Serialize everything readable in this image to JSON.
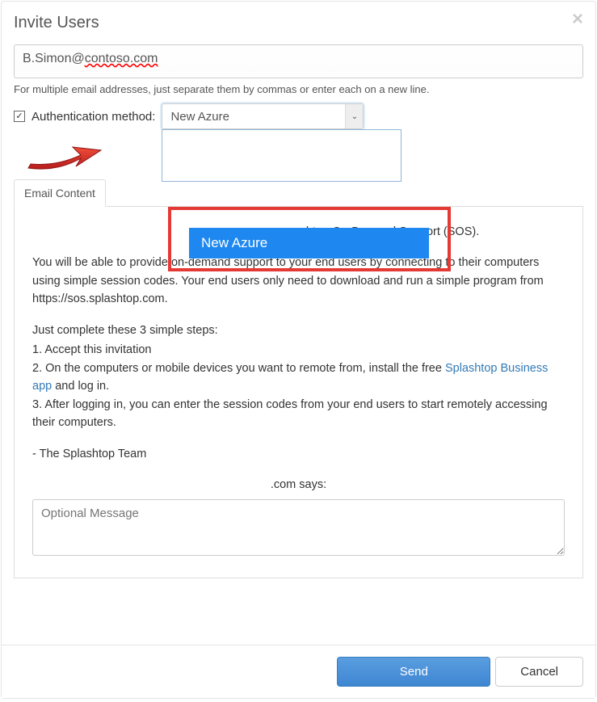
{
  "modal": {
    "title": "Invite Users",
    "close_label": "×"
  },
  "email": {
    "value": "B.Simon@contoso.com",
    "hint": "For multiple email addresses, just separate them by commas or enter each on a new line."
  },
  "auth": {
    "checked": true,
    "label": "Authentication method:",
    "selected": "New Azure",
    "options_visible": {
      "highlighted": "New Azure"
    }
  },
  "tabs": {
    "email_content": "Email Content"
  },
  "email_content": {
    "p1_suffix": "ashtop On-Demand Support (SOS).",
    "p2": "You will be able to provide on-demand support to your end users by connecting to their computers using simple session codes. Your end users only need to download and run a simple program from https://sos.splashtop.com.",
    "p3": "Just complete these 3 simple steps:",
    "s1": "1. Accept this invitation",
    "s2a": "2. On the computers or mobile devices you want to remote from, install the free ",
    "s2_link": "Splashtop Business app",
    "s2b": " and log in.",
    "s3": "3. After logging in, you can enter the session codes from your end users to start remotely accessing their computers.",
    "signoff": "- The Splashtop Team",
    "com_says": ".com says:",
    "optional_placeholder": "Optional Message"
  },
  "footer": {
    "send": "Send",
    "cancel": "Cancel"
  }
}
